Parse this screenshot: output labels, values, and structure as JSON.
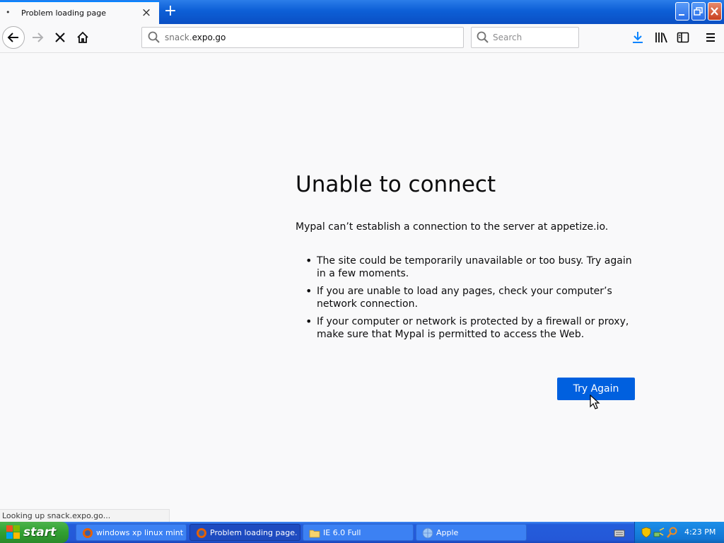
{
  "tab": {
    "title": "Problem loading page",
    "bullet": "•"
  },
  "toolbar": {
    "url_host_prefix": "snack.",
    "url_host_main": "expo.go",
    "search_placeholder": "Search"
  },
  "error": {
    "title": "Unable to connect",
    "description": "Mypal can’t establish a connection to the server at appetize.io.",
    "bullets": [
      "The site could be temporarily unavailable or too busy. Try again in a few moments.",
      "If you are unable to load any pages, check your computer’s network connection.",
      "If your computer or network is protected by a firewall or proxy, make sure that Mypal is permitted to access the Web."
    ],
    "button": "Try Again"
  },
  "status_text": "Looking up snack.expo.go...",
  "taskbar": {
    "start_label": "start",
    "tasks": [
      {
        "label": "windows xp linux mint...",
        "icon": "firefox-icon"
      },
      {
        "label": "Problem loading page...",
        "icon": "firefox-icon"
      },
      {
        "label": "IE 6.0 Full",
        "icon": "folder-icon"
      },
      {
        "label": "Apple",
        "icon": "globe-icon"
      }
    ],
    "clock": "4:23 PM"
  },
  "colors": {
    "accent": "#0060df",
    "taskbar": "#2458d8",
    "start": "#31a031",
    "close": "#c8401f"
  }
}
